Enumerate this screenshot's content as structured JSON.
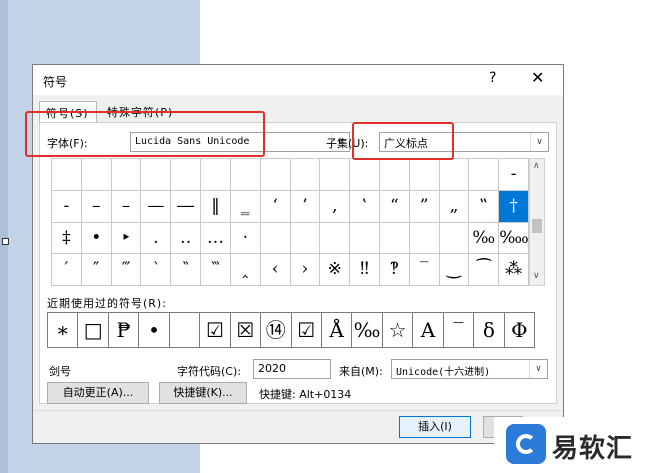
{
  "dialog": {
    "title": "符号",
    "help": "?",
    "close": "✕"
  },
  "tabs": [
    {
      "label": "符号(S)"
    },
    {
      "label": "特殊字符(P)"
    }
  ],
  "font": {
    "label": "字体(F):",
    "value": "Lucida Sans Unicode"
  },
  "subset": {
    "label": "子集(U):",
    "value": "广义标点"
  },
  "grid": {
    "rows": [
      [
        "",
        "",
        "",
        "",
        "",
        "",
        "",
        "",
        "",
        "",
        "",
        "",
        "",
        "",
        "",
        "-"
      ],
      [
        "-",
        "–",
        "–",
        "—",
        "―",
        "‖",
        "‗",
        "‘",
        "’",
        "‚",
        "‛",
        "“",
        "”",
        "„",
        "‟",
        "†"
      ],
      [
        "‡",
        "•",
        "‣",
        "․",
        "‥",
        "…",
        "‧",
        "",
        "",
        "",
        "",
        "",
        "",
        "",
        "‰",
        "‱"
      ],
      [
        "′",
        "″",
        "‴",
        "‵",
        "‶",
        "‷",
        "‸",
        "‹",
        "›",
        "※",
        "‼",
        "‽",
        "‾",
        "‿",
        "⁀",
        "⁂"
      ]
    ],
    "selected": {
      "row": 1,
      "col": 15
    }
  },
  "recent": {
    "label": "近期使用过的符号(R):",
    "symbols": [
      "∗",
      "□",
      "₱",
      "•",
      "",
      "☑",
      "☒",
      "⑭",
      "☑",
      "Å",
      "‰",
      "☆",
      "A",
      "‾",
      "δ",
      "Φ"
    ]
  },
  "char_name": "剑号",
  "char_code": {
    "label": "字符代码(C):",
    "value": "2020"
  },
  "from": {
    "label": "来自(M):",
    "value": "Unicode(十六进制)"
  },
  "buttons": {
    "autocorrect": "自动更正(A)...",
    "shortcut_key": "快捷键(K)...",
    "insert": "插入(I)"
  },
  "shortcut_text": "快捷键: Alt+0134",
  "watermark": {
    "text": "易软汇"
  }
}
